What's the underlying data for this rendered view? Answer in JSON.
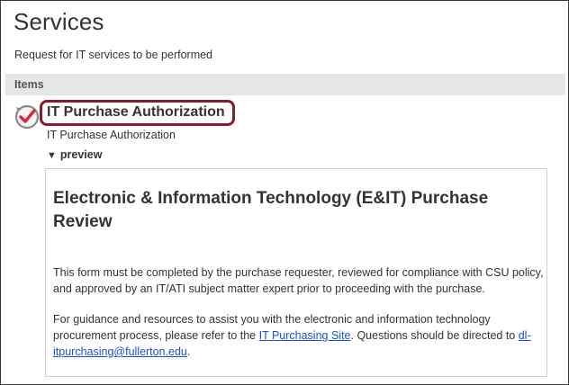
{
  "page": {
    "title": "Services",
    "description": "Request for IT services to be performed"
  },
  "items_section": {
    "label": "Items"
  },
  "item": {
    "icon": "checkmark-refresh-icon",
    "title": "IT Purchase Authorization",
    "subtitle": "IT Purchase Authorization",
    "highlight_color": "#8b1a2b",
    "icon_color": "#d9263a"
  },
  "preview": {
    "toggle_label": "preview",
    "heading_line1": "Electronic & Information Technology (E&IT) Purchase",
    "heading_line2": "Review",
    "para1": "This form must be completed by the purchase requester, reviewed for compliance with CSU policy, and approved by an IT/ATI subject matter expert prior to proceeding with the purchase.",
    "para2_prefix": "For guidance and resources to assist you with the electronic and information technology procurement process, please refer to the ",
    "para2_link": "IT Purchasing Site",
    "para2_middle": ". Questions should be directed to ",
    "para2_email": "dl-itpurchasing@fullerton.edu",
    "para2_suffix": ".",
    "link_color": "#1a4fd6"
  }
}
